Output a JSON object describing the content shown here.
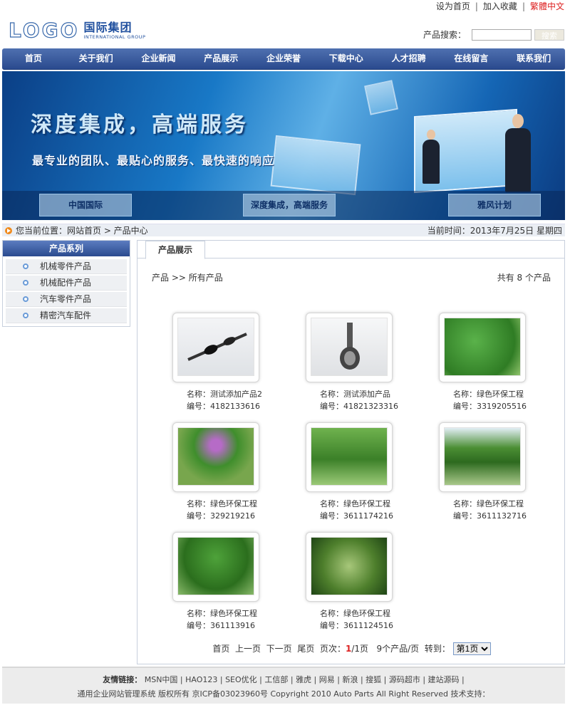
{
  "toplinks": {
    "home": "设为首页",
    "fav": "加入收藏",
    "lang": "繁體中文"
  },
  "logo": {
    "mark": "LOGO",
    "cn": "国际集团",
    "en": "INTERNATIONAL GROUP"
  },
  "search": {
    "label": "产品搜索：",
    "button": "搜索"
  },
  "nav": [
    "首页",
    "关于我们",
    "企业新闻",
    "产品展示",
    "企业荣誉",
    "下载中心",
    "人才招聘",
    "在线留言",
    "联系我们"
  ],
  "banner": {
    "title": "深度集成，高端服务",
    "subtitle": "最专业的团队、最贴心的服务、最快速的响应",
    "thumbs": [
      "中国国际",
      "深度集成，高端服务",
      "雅风计划"
    ]
  },
  "crumb": {
    "left": "您当前位置：网站首页 > 产品中心",
    "right": "当前时间：2013年7月25日 星期四"
  },
  "sidebar": {
    "title": "产品系列",
    "items": [
      "机械零件产品",
      "机械配件产品",
      "汽车零件产品",
      "精密汽车配件"
    ]
  },
  "content": {
    "tab": "产品展示",
    "path": "产品 >> 所有产品",
    "count": "共有 8 个产品",
    "products": [
      {
        "name": "名称：测试添加产品2",
        "code": "编号：4182133616",
        "img": "shaft"
      },
      {
        "name": "名称：测试添加产品",
        "code": "编号：41821323316",
        "img": "joint"
      },
      {
        "name": "名称：绿色环保工程",
        "code": "编号：3319205516",
        "img": "tree1"
      },
      {
        "name": "名称：绿色环保工程",
        "code": "编号：329219216",
        "img": "tree2"
      },
      {
        "name": "名称：绿色环保工程",
        "code": "编号：3611174216",
        "img": "tree3"
      },
      {
        "name": "名称：绿色环保工程",
        "code": "编号：3611132716",
        "img": "tree4"
      },
      {
        "name": "名称：绿色环保工程",
        "code": "编号：361113916",
        "img": "tree5"
      },
      {
        "name": "名称：绿色环保工程",
        "code": "编号：3611124516",
        "img": "tree6"
      }
    ],
    "pager": {
      "first": "首页",
      "prev": "上一页",
      "next": "下一页",
      "last": "尾页",
      "page_label": "页次：",
      "current": "1",
      "total": "/1页",
      "per_page": "9个产品/页",
      "goto": "转到：",
      "select": "第1页"
    }
  },
  "footer": {
    "links_label": "友情链接：",
    "links": "MSN中国 | HAO123 | SEO优化 | 工信部 | 雅虎 | 网易 | 新浪 | 搜狐 | 源码超市 | 建站源码 |",
    "copyright": "通用企业网站管理系统 版权所有 京ICP备03023960号 Copyright 2010 Auto Parts All Right Reserved  技术支持："
  }
}
